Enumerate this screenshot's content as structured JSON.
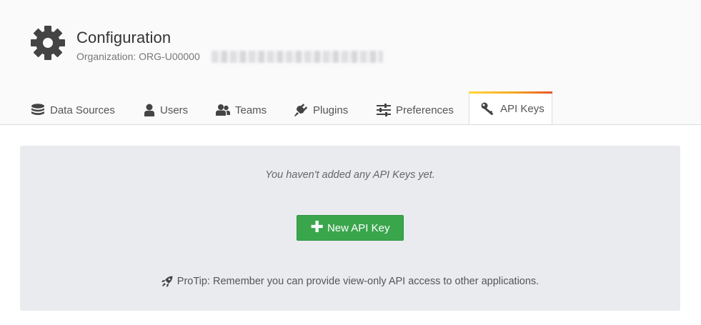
{
  "header": {
    "title": "Configuration",
    "org_label": "Organization: ORG-U00000",
    "icon": "gear-icon"
  },
  "tabs": [
    {
      "label": "Data Sources",
      "icon": "database-icon",
      "active": false
    },
    {
      "label": "Users",
      "icon": "user-icon",
      "active": false
    },
    {
      "label": "Teams",
      "icon": "users-icon",
      "active": false
    },
    {
      "label": "Plugins",
      "icon": "plug-icon",
      "active": false
    },
    {
      "label": "Preferences",
      "icon": "sliders-icon",
      "active": false
    },
    {
      "label": "API Keys",
      "icon": "key-icon",
      "active": true
    }
  ],
  "empty": {
    "message": "You haven't added any API Keys yet.",
    "button_label": "New API Key",
    "protip": "ProTip: Remember you can provide view-only API access to other applications."
  },
  "colors": {
    "primary_button": "#3aa64c",
    "panel_bg": "#e9ebef",
    "active_tab_accent": "#f6a623"
  }
}
